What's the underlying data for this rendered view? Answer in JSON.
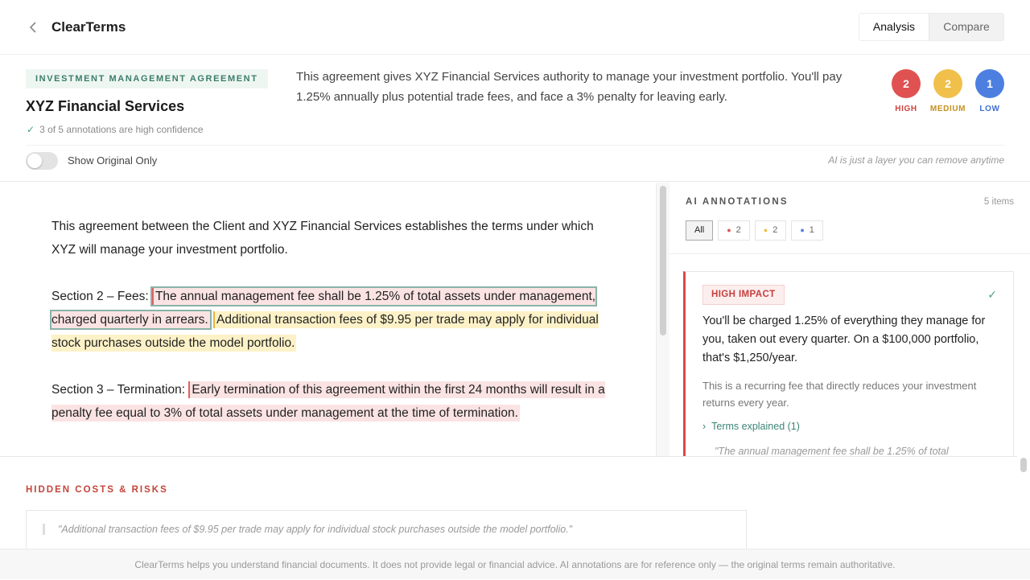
{
  "app": {
    "title": "ClearTerms",
    "back_icon": "chevron-left-icon"
  },
  "view_tabs": [
    {
      "label": "Analysis",
      "active": true
    },
    {
      "label": "Compare",
      "active": false
    }
  ],
  "summary": {
    "doc_type": "INVESTMENT MANAGEMENT AGREEMENT",
    "company": "XYZ Financial Services",
    "confidence": "3 of 5 annotations are high confidence",
    "text": "This agreement gives XYZ Financial Services authority to manage your investment portfolio. You'll pay 1.25% annually plus potential trade fees, and face a 3% penalty for leaving early.",
    "counts": [
      {
        "count": "2",
        "label": "HIGH",
        "color": "#e05252"
      },
      {
        "count": "2",
        "label": "MEDIUM",
        "color": "#f1c04b"
      },
      {
        "count": "1",
        "label": "LOW",
        "color": "#4c7fe0"
      }
    ],
    "toggle_label": "Show Original Only",
    "toggle_on": false,
    "ai_note": "AI is just a layer you can remove anytime"
  },
  "document": {
    "intro": "This agreement between the Client and XYZ Financial Services establishes the terms under which XYZ will manage your investment portfolio.",
    "s2_label": "Section 2 – Fees:",
    "s2_h1": "The annual management fee shall be 1.25% of total assets under management, charged quarterly in arrears.",
    "s2_h2": "Additional transaction fees of $9.95 per trade may apply for individual stock purchases outside the model portfolio.",
    "s3_label": "Section 3 – Termination:",
    "s3_h1": "Early termination of this agreement within the first 24 months will result in a penalty fee equal to 3% of total assets under management at the time of termination."
  },
  "annotations": {
    "title": "AI ANNOTATIONS",
    "count": "5 items",
    "filters": [
      {
        "label": "All",
        "active": true
      },
      {
        "label": "2",
        "color": "#e05252"
      },
      {
        "label": "2",
        "color": "#f1c04b"
      },
      {
        "label": "1",
        "color": "#4c7fe0"
      }
    ],
    "card": {
      "impact": "HIGH IMPACT",
      "text": "You'll be charged 1.25% of everything they manage for you, taken out every quarter. On a $100,000 portfolio, that's $1,250/year.",
      "sub": "This is a recurring fee that directly reduces your investment returns every year.",
      "terms": "Terms explained (1)",
      "quote": "\"The annual management fee shall be 1.25% of total"
    }
  },
  "hidden": {
    "title": "HIDDEN COSTS & RISKS",
    "quote": "\"Additional transaction fees of $9.95 per trade may apply for individual stock purchases outside the model portfolio.\""
  },
  "footer": "ClearTerms helps you understand financial documents. It does not provide legal or financial advice. AI annotations are for reference only — the original terms remain authoritative."
}
